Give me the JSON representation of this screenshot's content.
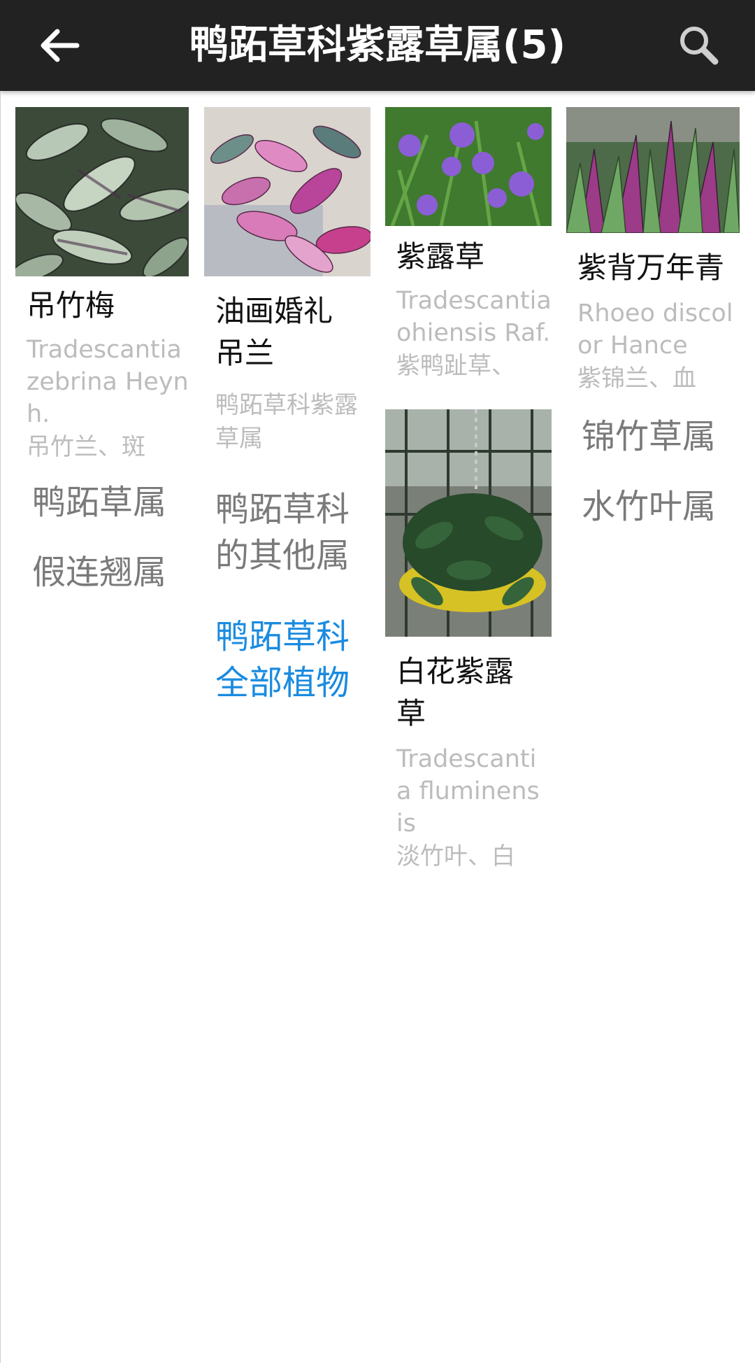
{
  "header": {
    "title": "鸭跖草科紫露草属(5)"
  },
  "columns": [
    {
      "cards": [
        {
          "name": "吊竹梅",
          "latin": "Tradescantia zebrina Heynh.",
          "alias": "吊竹兰、斑"
        }
      ],
      "links": [
        {
          "label": "鸭跖草属"
        },
        {
          "label": "假连翘属"
        }
      ]
    },
    {
      "cards": [
        {
          "name": "油画婚礼吊兰",
          "latin": "",
          "alias": "鸭跖草科紫露草属"
        }
      ],
      "links": [
        {
          "label": "鸭跖草科的其他属"
        },
        {
          "label": "鸭跖草科全部植物",
          "accent": "#1a8be0"
        }
      ]
    },
    {
      "cards": [
        {
          "name": "紫露草",
          "latin": "Tradescantia ohiensis Raf.",
          "alias": "紫鸭趾草、"
        },
        {
          "name": "白花紫露草",
          "latin": "Tradescantia fluminensis",
          "alias": "淡竹叶、白"
        }
      ],
      "links": []
    },
    {
      "cards": [
        {
          "name": "紫背万年青",
          "latin": "Rhoeo discolor Hance",
          "alias": "紫锦兰、血"
        }
      ],
      "links": [
        {
          "label": "锦竹草属"
        },
        {
          "label": "水竹叶属"
        }
      ]
    }
  ],
  "colors": {
    "topbar": "#222222",
    "link_gray": "#7a7a7a",
    "link_blue": "#1a8be0",
    "secondary_text": "#bcbcbc"
  },
  "icons": [
    "back-arrow-icon",
    "search-icon"
  ]
}
